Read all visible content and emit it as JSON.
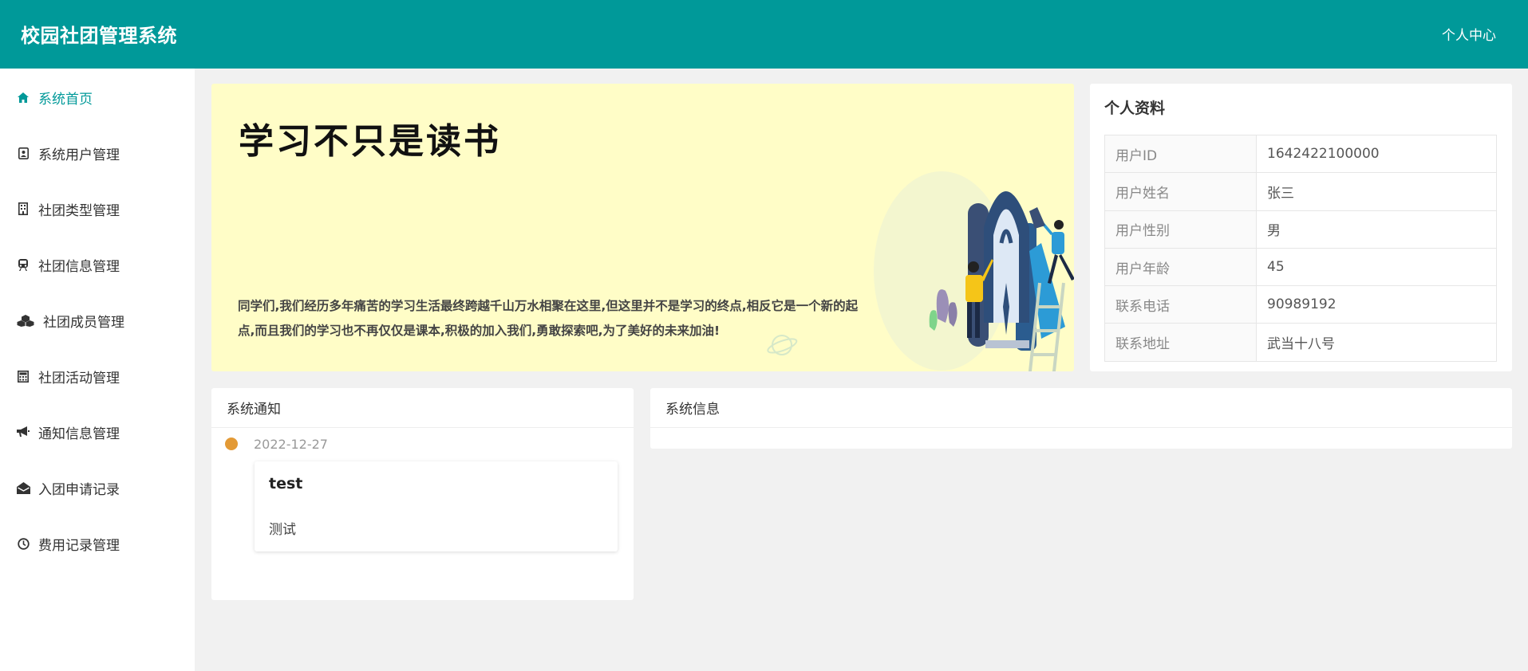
{
  "header": {
    "app_title": "校园社团管理系统",
    "user_center": "个人中心"
  },
  "colors": {
    "accent": "#009999",
    "banner_bg": "#fffdc7",
    "timeline_dot": "#e39a36"
  },
  "sidebar": {
    "items": [
      {
        "label": "系统首页",
        "icon": "home-icon",
        "active": true
      },
      {
        "label": "系统用户管理",
        "icon": "user-card-icon",
        "active": false
      },
      {
        "label": "社团类型管理",
        "icon": "building-icon",
        "active": false
      },
      {
        "label": "社团信息管理",
        "icon": "train-icon",
        "active": false
      },
      {
        "label": "社团成员管理",
        "icon": "cubes-icon",
        "active": false
      },
      {
        "label": "社团活动管理",
        "icon": "calculator-icon",
        "active": false
      },
      {
        "label": "通知信息管理",
        "icon": "bullhorn-icon",
        "active": false
      },
      {
        "label": "入团申请记录",
        "icon": "envelope-open-icon",
        "active": false
      },
      {
        "label": "费用记录管理",
        "icon": "clock-icon",
        "active": false
      }
    ]
  },
  "banner": {
    "title": "学习不只是读书",
    "text": "同学们,我们经历多年痛苦的学习生活最终跨越千山万水相聚在这里,但这里并不是学习的终点,相反它是一个新的起点,而且我们的学习也不再仅仅是课本,积极的加入我们,勇敢探索吧,为了美好的未来加油!"
  },
  "profile": {
    "title": "个人资料",
    "rows": [
      {
        "key": "用户ID",
        "value": "1642422100000"
      },
      {
        "key": "用户姓名",
        "value": "张三"
      },
      {
        "key": "用户性别",
        "value": "男"
      },
      {
        "key": "用户年龄",
        "value": "45"
      },
      {
        "key": "联系电话",
        "value": "90989192"
      },
      {
        "key": "联系地址",
        "value": "武当十八号"
      }
    ]
  },
  "notices": {
    "title": "系统通知",
    "items": [
      {
        "date": "2022-12-27",
        "title": "test",
        "content": "测试"
      }
    ]
  },
  "system_info": {
    "title": "系统信息"
  }
}
